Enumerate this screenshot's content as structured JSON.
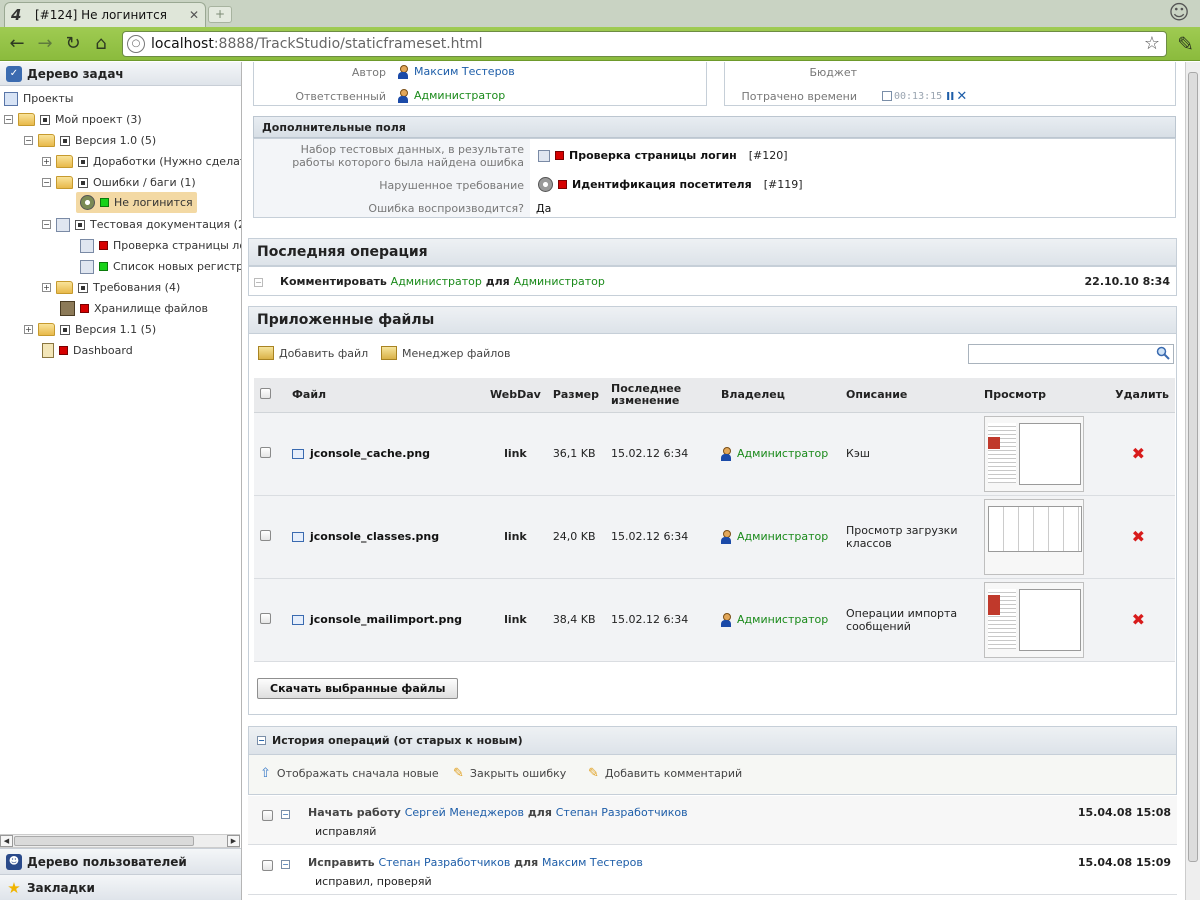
{
  "browser": {
    "tab_title": "[#124] Не логинится",
    "tab_logo": "4",
    "url_host": "localhost",
    "url_path": ":8888/TrackStudio/staticframeset.html"
  },
  "left_panel": {
    "header": "Дерево задач",
    "tree": [
      {
        "label": "Проекты"
      },
      {
        "label": "Мой проект (3)"
      },
      {
        "label": "Версия 1.0 (5)"
      },
      {
        "label": "Доработки (Нужно сделат"
      },
      {
        "label": "Ошибки / баги (1)"
      },
      {
        "label": "Не логинится"
      },
      {
        "label": "Тестовая документация (2"
      },
      {
        "label": "Проверка страницы ло"
      },
      {
        "label": "Список новых регистра"
      },
      {
        "label": "Требования (4)"
      },
      {
        "label": "Хранилище файлов"
      },
      {
        "label": "Версия 1.1 (5)"
      },
      {
        "label": "Dashboard"
      }
    ],
    "footer_users": "Дерево пользователей",
    "footer_bookmarks": "Закладки"
  },
  "properties": {
    "author_label": "Автор",
    "author_value": "Максим Тестеров",
    "responsible_label": "Ответственный",
    "responsible_value": "Администратор",
    "budget_label": "Бюджет",
    "spent_label": "Потрачено времени",
    "spent_value": "00:13:15"
  },
  "extra_fields": {
    "title": "Дополнительные поля",
    "f1_label_line1": "Набор тестовых данных, в результате",
    "f1_label_line2": "работы которого была найдена ошибка",
    "f1_value": "Проверка страницы логин",
    "f1_id": "[#120]",
    "f2_label": "Нарушенное требование",
    "f2_value": "Идентификация посетителя",
    "f2_id": "[#119]",
    "f3_label": "Ошибка воспроизводится?",
    "f3_value": "Да"
  },
  "last_op": {
    "title": "Последняя операция",
    "action": "Комментировать",
    "who": "Администратор",
    "for_word": "для",
    "whom": "Администратор",
    "date": "22.10.10 8:34"
  },
  "files": {
    "title": "Приложенные файлы",
    "add_label": "Добавить файл",
    "manager_label": "Менеджер файлов",
    "search_placeholder": "",
    "headers": {
      "file": "Файл",
      "webdav": "WebDav",
      "size": "Размер",
      "modified_line1": "Последнее",
      "modified_line2": "изменение",
      "owner": "Владелец",
      "description": "Описание",
      "preview": "Просмотр",
      "delete": "Удалить"
    },
    "rows": [
      {
        "name": "jconsole_cache.png",
        "webdav": "link",
        "size": "36,1 KB",
        "date": "15.02.12 6:34",
        "owner": "Администратор",
        "desc_line1": "Кэш",
        "desc_line2": ""
      },
      {
        "name": "jconsole_classes.png",
        "webdav": "link",
        "size": "24,0 KB",
        "date": "15.02.12 6:34",
        "owner": "Администратор",
        "desc_line1": "Просмотр загрузки",
        "desc_line2": "классов"
      },
      {
        "name": "jconsole_mailimport.png",
        "webdav": "link",
        "size": "38,4 KB",
        "date": "15.02.12 6:34",
        "owner": "Администратор",
        "desc_line1": "Операции импорта",
        "desc_line2": "сообщений"
      }
    ],
    "download_button": "Скачать выбранные файлы"
  },
  "history": {
    "title": "История операций (от старых к новым)",
    "show_new_first": "Отображать сначала новые",
    "close_bug": "Закрыть ошибку",
    "add_comment": "Добавить комментарий",
    "items": [
      {
        "action": "Начать работу",
        "who": "Сергей Менеджеров",
        "for_word": "для",
        "whom": "Степан Разработчиков",
        "date": "15.04.08 15:08",
        "comment": "исправляй"
      },
      {
        "action": "Исправить",
        "who": "Степан Разработчиков",
        "for_word": "для",
        "whom": "Максим Тестеров",
        "date": "15.04.08 15:09",
        "comment": "исправил, проверяй"
      }
    ]
  },
  "colors": {
    "toolbar_green": "#8bbb3d",
    "link_blue": "#1d5da8",
    "link_green": "#1a8a1a",
    "status_red": "#d60000",
    "status_green": "#19d219",
    "selected": "#f3d9a4"
  }
}
